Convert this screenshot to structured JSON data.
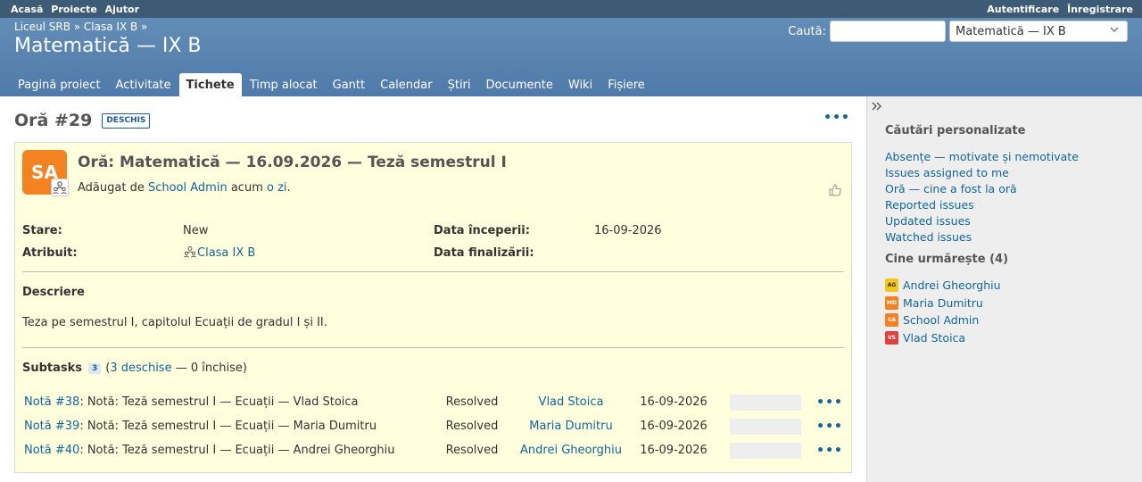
{
  "top_menu": {
    "left": [
      "Acasă",
      "Proiecte",
      "Ajutor"
    ],
    "right": [
      "Autentificare",
      "Înregistrare"
    ]
  },
  "header": {
    "breadcrumb": "Liceul SRB » Clasa IX B »",
    "title": "Matematică — IX B",
    "search_label": "Caută:",
    "search_value": "",
    "project_select": "Matematică — IX B"
  },
  "tabs": [
    "Pagină proiect",
    "Activitate",
    "Tichete",
    "Timp alocat",
    "Gantt",
    "Calendar",
    "Știri",
    "Documente",
    "Wiki",
    "Fișiere"
  ],
  "issue": {
    "title": "Oră #29",
    "status_badge": "DESCHIS",
    "avatar_initials": "SA",
    "subject": "Oră: Matematică — 16.09.2026 — Teză semestrul I",
    "author_prefix": "Adăugat de",
    "author": "School Admin",
    "time_prefix": "acum",
    "time_link": "o zi",
    "time_suffix": ".",
    "attributes": {
      "status_label": "Stare:",
      "status_value": "New",
      "assignee_label": "Atribuit:",
      "assignee_value": "Clasa IX B",
      "start_label": "Data începerii:",
      "start_value": "16-09-2026",
      "due_label": "Data finalizării:",
      "due_value": ""
    },
    "description_title": "Descriere",
    "description_text": "Teza pe semestrul I, capitolul Ecuații de gradul I și II.",
    "subtasks": {
      "label": "Subtasks",
      "count": "3",
      "open_prefix": "(",
      "open_link": "3 deschise",
      "closed_text": "— 0 închise)",
      "rows": [
        {
          "id": "Notă #38",
          "subject": ": Notă: Teză semestrul I — Ecuații — Vlad Stoica",
          "status": "Resolved",
          "assignee": "Vlad Stoica",
          "date": "16-09-2026"
        },
        {
          "id": "Notă #39",
          "subject": ": Notă: Teză semestrul I — Ecuații — Maria Dumitru",
          "status": "Resolved",
          "assignee": "Maria Dumitru",
          "date": "16-09-2026"
        },
        {
          "id": "Notă #40",
          "subject": ": Notă: Teză semestrul I — Ecuații — Andrei Gheorghiu",
          "status": "Resolved",
          "assignee": "Andrei Gheorghiu",
          "date": "16-09-2026"
        }
      ]
    }
  },
  "sidebar": {
    "custom_queries_title": "Căutări personalizate",
    "queries": [
      "Absențe — motivate și nemotivate",
      "Issues assigned to me",
      "Oră — cine a fost la oră",
      "Reported issues",
      "Updated issues",
      "Watched issues"
    ],
    "watchers_title": "Cine urmărește (4)",
    "watchers": [
      {
        "initials": "AG",
        "name": "Andrei Gheorghiu",
        "color": "#f5c518"
      },
      {
        "initials": "MD",
        "name": "Maria Dumitru",
        "color": "#f58220"
      },
      {
        "initials": "SA",
        "name": "School Admin",
        "color": "#f58220"
      },
      {
        "initials": "VS",
        "name": "Vlad Stoica",
        "color": "#e04040"
      }
    ]
  },
  "colors": {
    "header": "#507aaa",
    "top_menu": "#3e5b76",
    "issue_bg": "#ffffdd",
    "link": "#169",
    "avatar": "#f58220"
  }
}
